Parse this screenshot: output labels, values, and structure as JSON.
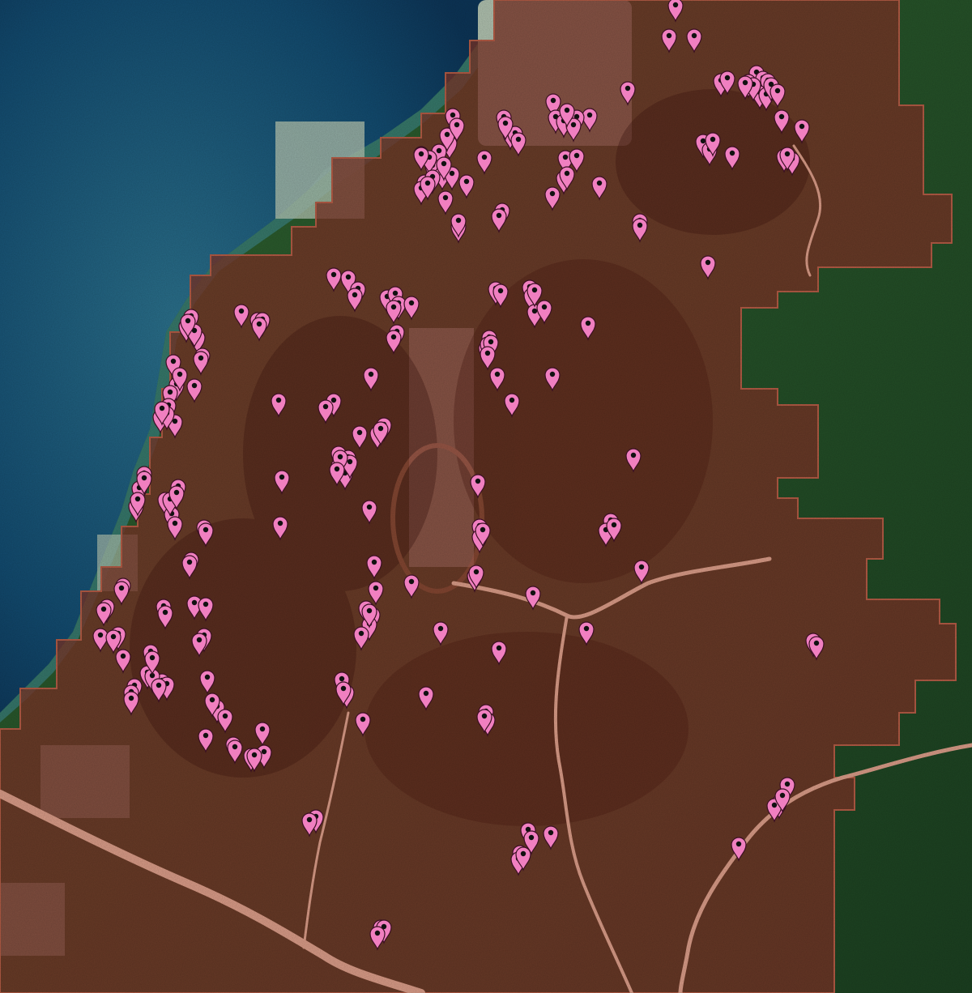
{
  "map": {
    "type": "satellite",
    "overlay": {
      "color": "#7a3326",
      "opacity": 0.78,
      "edge_color": "#b25a44"
    },
    "marker": {
      "color": "#f07fc0",
      "outline": "#3a0f22",
      "dot": "#111111"
    },
    "colors": {
      "sea_deep": "#0e3d63",
      "sea_shallow": "#3c8a99",
      "forest": "#2d5a2b",
      "forest_dark": "#1c3f1f",
      "urban": "#b7c2b2",
      "river": "#d79a86"
    },
    "marker_count": 238
  }
}
